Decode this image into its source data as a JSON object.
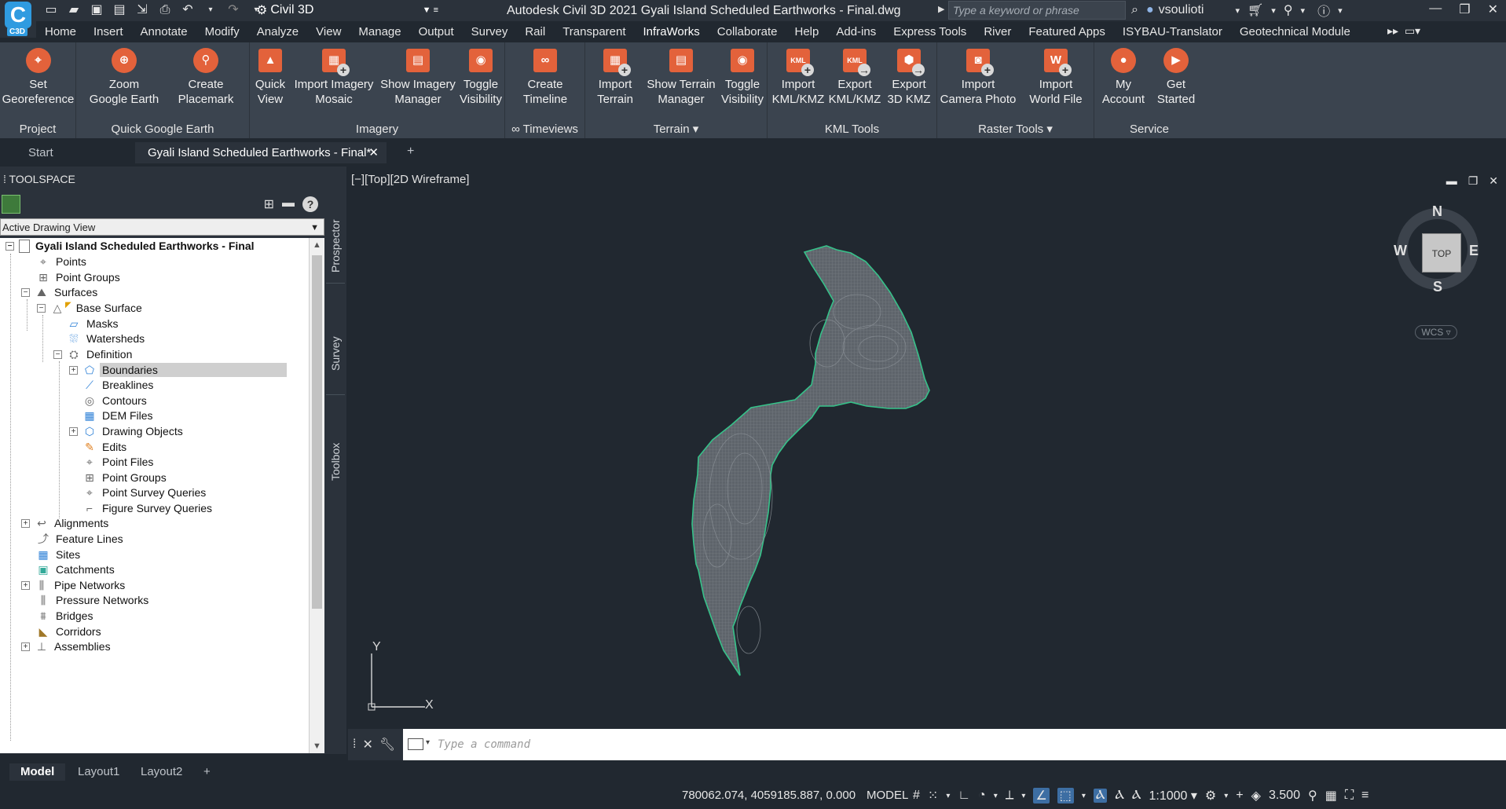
{
  "app": {
    "logo_letter": "C",
    "logo_tag": "C3D",
    "workspace": "Civil 3D",
    "window_title": "Autodesk Civil 3D 2021    Gyali Island Scheduled Earthworks - Final.dwg",
    "search_placeholder": "Type a keyword or phrase",
    "user": "vsoulioti"
  },
  "ribbon_tabs": [
    "Home",
    "Insert",
    "Annotate",
    "Modify",
    "Analyze",
    "View",
    "Manage",
    "Output",
    "Survey",
    "Rail",
    "Transparent",
    "InfraWorks",
    "Collaborate",
    "Help",
    "Add-ins",
    "Express Tools",
    "River",
    "Featured Apps",
    "ISYBAU-Translator",
    "Geotechnical Module"
  ],
  "ribbon": {
    "groups": [
      {
        "title": "Project"
      },
      {
        "title": "Quick Google Earth"
      },
      {
        "title": "Imagery"
      },
      {
        "title": "∞ Timeviews"
      },
      {
        "title": "Terrain ▾"
      },
      {
        "title": "KML Tools"
      },
      {
        "title": "Raster Tools ▾"
      },
      {
        "title": "Service"
      }
    ],
    "buttons": {
      "set_georeference": "Set\nGeoreference",
      "zoom_google_earth": "Zoom\nGoogle Earth",
      "create_placemark": "Create\nPlacemark",
      "quick_view": "Quick\nView",
      "import_imagery_mosaic": "Import Imagery\nMosaic",
      "show_imagery_manager": "Show Imagery\nManager",
      "toggle_visibility_imagery": "Toggle\nVisibility",
      "create_timeline": "Create\nTimeline",
      "import_terrain": "Import\nTerrain",
      "show_terrain_manager": "Show Terrain\nManager",
      "toggle_visibility_terrain": "Toggle\nVisibility",
      "import_kml": "Import\nKML/KMZ",
      "export_kml": "Export\nKML/KMZ",
      "export_3d_kmz": "Export\n3D KMZ",
      "import_camera_photo": "Import\nCamera Photo",
      "import_world_file": "Import\nWorld File",
      "my_account": "My\nAccount",
      "get_started": "Get\nStarted"
    }
  },
  "doc_tabs": {
    "start": "Start",
    "active": "Gyali Island Scheduled Earthworks - Final*"
  },
  "toolspace": {
    "title": "TOOLSPACE",
    "view_select": "Active Drawing View",
    "side_tabs": [
      "Prospector",
      "Survey",
      "Toolbox"
    ],
    "tree": {
      "root": "Gyali Island Scheduled Earthworks - Final",
      "points": "Points",
      "point_groups": "Point Groups",
      "surfaces": "Surfaces",
      "base_surface": "Base Surface",
      "masks": "Masks",
      "watersheds": "Watersheds",
      "definition": "Definition",
      "boundaries": "Boundaries",
      "breaklines": "Breaklines",
      "contours": "Contours",
      "dem_files": "DEM Files",
      "drawing_objects": "Drawing Objects",
      "edits": "Edits",
      "point_files": "Point Files",
      "def_point_groups": "Point Groups",
      "point_survey_queries": "Point Survey Queries",
      "figure_survey_queries": "Figure Survey Queries",
      "alignments": "Alignments",
      "feature_lines": "Feature Lines",
      "sites": "Sites",
      "catchments": "Catchments",
      "pipe_networks": "Pipe Networks",
      "pressure_networks": "Pressure Networks",
      "bridges": "Bridges",
      "corridors": "Corridors",
      "assemblies": "Assemblies"
    }
  },
  "viewport": {
    "label": "[−][Top][2D Wireframe]",
    "viewcube": {
      "top": "TOP",
      "n": "N",
      "s": "S",
      "e": "E",
      "w": "W",
      "wcs": "WCS ▿"
    },
    "ucs_x": "X",
    "ucs_y": "Y",
    "boundary_color": "#36c28a"
  },
  "command_line": {
    "placeholder": "Type a command"
  },
  "layout_tabs": [
    "Model",
    "Layout1",
    "Layout2"
  ],
  "status_bar": {
    "coordinates": "780062.074, 4059185.887, 0.000",
    "mode": "MODEL",
    "scale": "1:1000 ▾",
    "lineweight": "3.500"
  }
}
